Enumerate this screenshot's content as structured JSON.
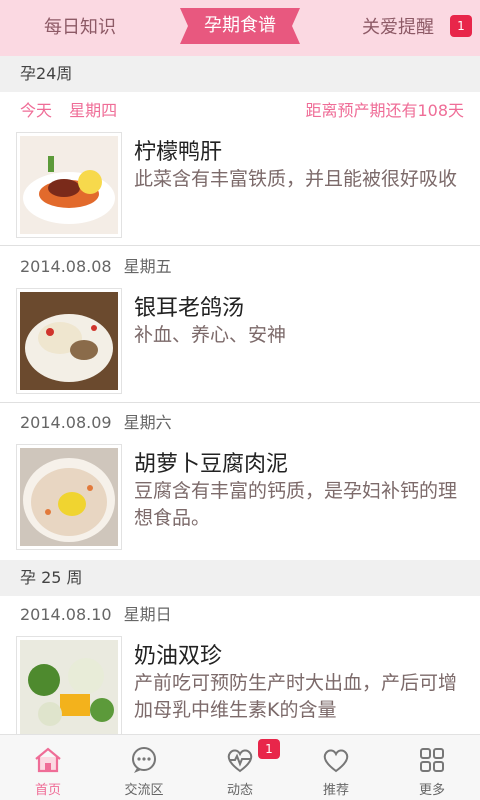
{
  "header": {
    "tab_left": "每日知识",
    "tab_active": "孕期食谱",
    "tab_right": "关爱提醒",
    "badge": "1"
  },
  "week24": {
    "label": "孕24周"
  },
  "today": {
    "label": "今天",
    "weekday": "星期四",
    "countdown": "距离预产期还有108天"
  },
  "recipes": [
    {
      "title": "柠檬鸭肝",
      "desc": "此菜含有丰富铁质，并且能被很好吸收"
    },
    {
      "date": "2014.08.08",
      "weekday": "星期五",
      "title": "银耳老鸽汤",
      "desc": "补血、养心、安神"
    },
    {
      "date": "2014.08.09",
      "weekday": "星期六",
      "title": "胡萝卜豆腐肉泥",
      "desc": "豆腐含有丰富的钙质，是孕妇补钙的理想食品。"
    },
    {
      "date": "2014.08.10",
      "weekday": "星期日",
      "title": "奶油双珍",
      "desc": "产前吃可预防生产时大出血，产后可增加母乳中维生素K的含量"
    }
  ],
  "week25": {
    "label": "孕 25 周"
  },
  "nav": {
    "items": [
      {
        "label": "首页",
        "icon": "home-icon"
      },
      {
        "label": "交流区",
        "icon": "chat-icon"
      },
      {
        "label": "动态",
        "icon": "activity-icon"
      },
      {
        "label": "推荐",
        "icon": "heart-icon"
      },
      {
        "label": "更多",
        "icon": "grid-icon"
      }
    ],
    "badge": "1"
  },
  "colors": {
    "accent": "#ef6d97",
    "header_bg": "#fbd9e2",
    "badge": "#e8264a"
  }
}
